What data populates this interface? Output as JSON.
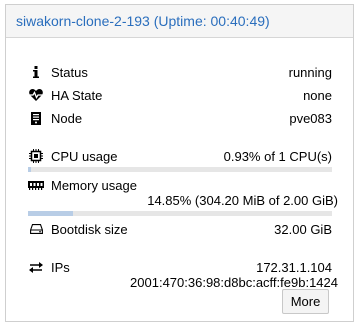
{
  "header": {
    "title": "siwakorn-clone-2-193 (Uptime: 00:40:49)"
  },
  "status": {
    "label": "Status",
    "value": "running"
  },
  "ha_state": {
    "label": "HA State",
    "value": "none"
  },
  "node": {
    "label": "Node",
    "value": "pve083"
  },
  "cpu": {
    "label": "CPU usage",
    "value": "0.93% of 1 CPU(s)",
    "fraction": 0.0093
  },
  "memory": {
    "label": "Memory usage",
    "value": "14.85% (304.20 MiB of 2.00 GiB)",
    "fraction": 0.1485
  },
  "bootdisk": {
    "label": "Bootdisk size",
    "value": "32.00 GiB"
  },
  "ips": {
    "label": "IPs",
    "values": [
      "172.31.1.104",
      "2001:470:36:98:d8bc:acff:fe9b:1424"
    ]
  },
  "more_button": {
    "label": "More"
  },
  "colors": {
    "title": "#2a6ebd",
    "bar_fill": "#b8cde6",
    "bar_track": "#e6e6e6"
  }
}
